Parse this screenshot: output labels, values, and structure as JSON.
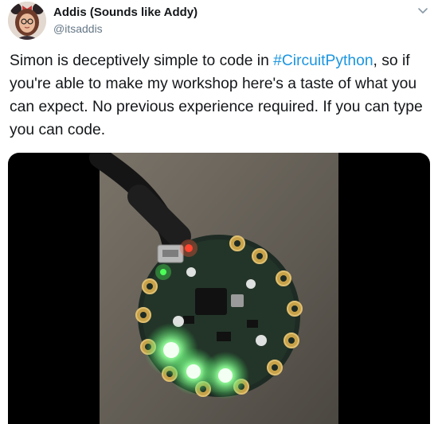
{
  "author": {
    "display_name": "Addis (Sounds like Addy)",
    "handle": "@itsaddis"
  },
  "tweet": {
    "text_before": "Simon is deceptively simple to code in ",
    "hashtag": "#CircuitPython",
    "text_after": ", so if you're able to make my workshop here's a taste of what you can expect. No previous experience required. If you can type you can code."
  },
  "icons": {
    "menu": "chevron-down-icon"
  },
  "colors": {
    "hashtag": "#1b95e0",
    "handle": "#657786",
    "text": "#14171a",
    "media_bg": "#000000",
    "led_green": "#7dff8a"
  }
}
